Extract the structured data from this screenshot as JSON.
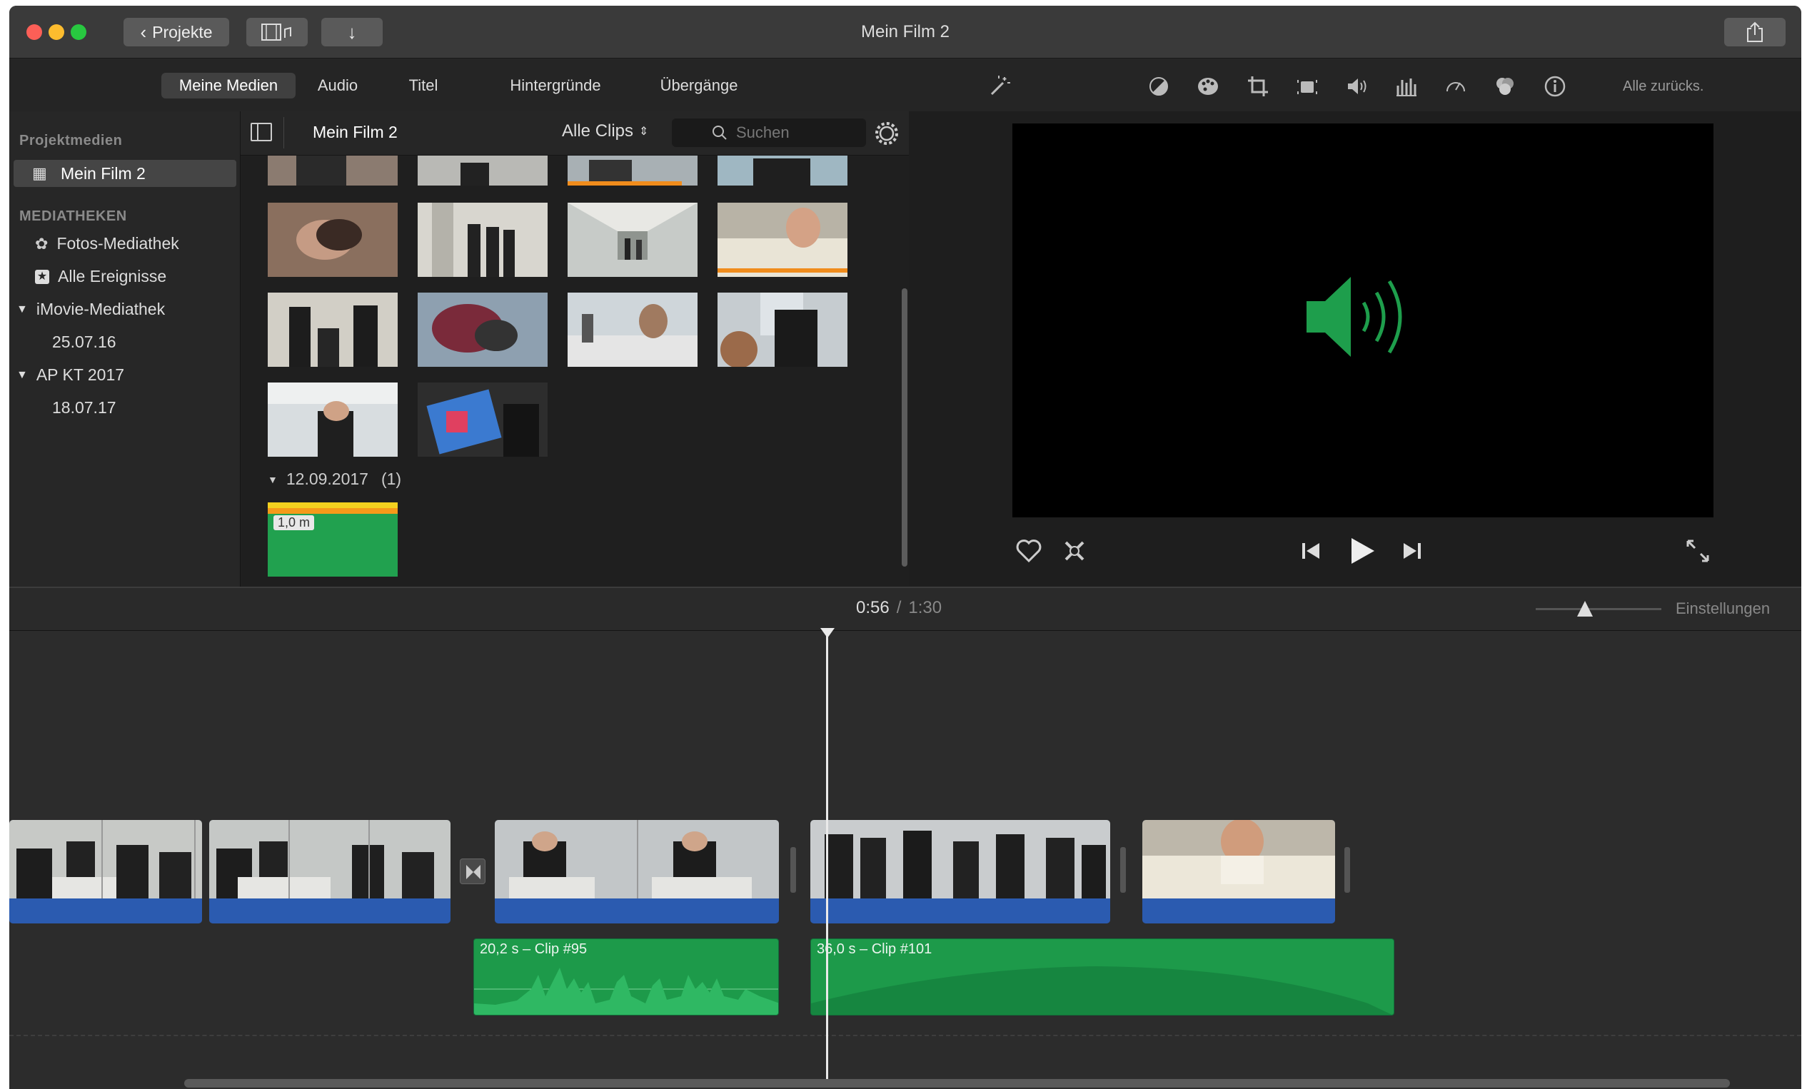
{
  "window": {
    "title": "Mein Film 2"
  },
  "toolbar": {
    "projects_label": "Projekte"
  },
  "media_tabs": [
    "Meine Medien",
    "Audio",
    "Titel",
    "Hintergründe",
    "Übergänge"
  ],
  "viewer_toolbar": {
    "reset_label": "Alle zurücks."
  },
  "sidebar": {
    "project_section": "Projektmedien",
    "project_item": "Mein Film 2",
    "libraries_section": "MEDIATHEKEN",
    "items": [
      {
        "label": "Fotos-Mediathek"
      },
      {
        "label": "Alle Ereignisse"
      },
      {
        "label": "iMovie-Mediathek"
      },
      {
        "label": "25.07.16"
      },
      {
        "label": "AP KT 2017"
      },
      {
        "label": "18.07.17"
      }
    ]
  },
  "browser": {
    "title": "Mein Film 2",
    "filter": "Alle Clips",
    "search_placeholder": "Suchen",
    "group_date": "12.09.2017",
    "group_count": "(1)",
    "audio_thumb_duration": "1,0 m"
  },
  "timecode": {
    "current": "0:56",
    "separator": "/",
    "total": "1:30"
  },
  "timeline": {
    "settings_label": "Einstellungen",
    "audio_clips": [
      {
        "label": "20,2 s – Clip #95"
      },
      {
        "label": "36,0 s – Clip #101"
      }
    ]
  },
  "colors": {
    "accent_green": "#1e9e4c",
    "audio_wave_blue": "#2b5bb0",
    "progress_orange": "#f0a020"
  }
}
